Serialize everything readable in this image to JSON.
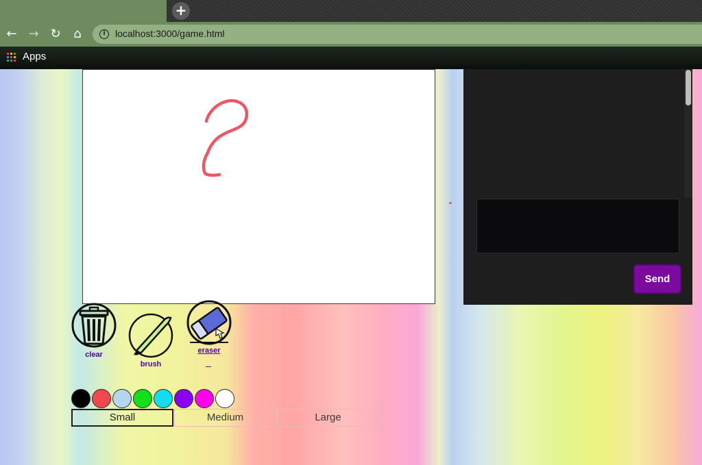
{
  "browser": {
    "newtab_symbol": "+",
    "url": "localhost:3000/game.html",
    "bookmarks_apps_label": "Apps",
    "nav": {
      "back": "←",
      "forward": "→",
      "reload": "↻",
      "home": "⌂",
      "info": "i"
    },
    "icons": [
      "back-icon",
      "forward-icon",
      "reload-icon",
      "home-icon",
      "info-icon",
      "apps-grid-icon"
    ]
  },
  "tools": {
    "clear_label": "clear",
    "brush_label": "brush",
    "eraser_label": "eraser",
    "eraser_sub": "-"
  },
  "palette": [
    {
      "name": "black",
      "color": "#000000"
    },
    {
      "name": "red",
      "color": "#f0484c"
    },
    {
      "name": "light-blue",
      "color": "#b5d6ef"
    },
    {
      "name": "green",
      "color": "#11e01b"
    },
    {
      "name": "cyan",
      "color": "#13dcf0"
    },
    {
      "name": "purple",
      "color": "#8a00f0"
    },
    {
      "name": "magenta",
      "color": "#ff00ee"
    },
    {
      "name": "white",
      "color": "#ffffff"
    }
  ],
  "sizes": {
    "small": "Small",
    "medium": "Medium",
    "large": "Large",
    "selected": "Small"
  },
  "chat": {
    "input_value": "",
    "send_label": "Send"
  },
  "colors": {
    "stroke": "#ef5663",
    "send_bg": "#7c0a9e",
    "tool_label": "#5000a8",
    "chat_bg": "#1e1e1f"
  }
}
